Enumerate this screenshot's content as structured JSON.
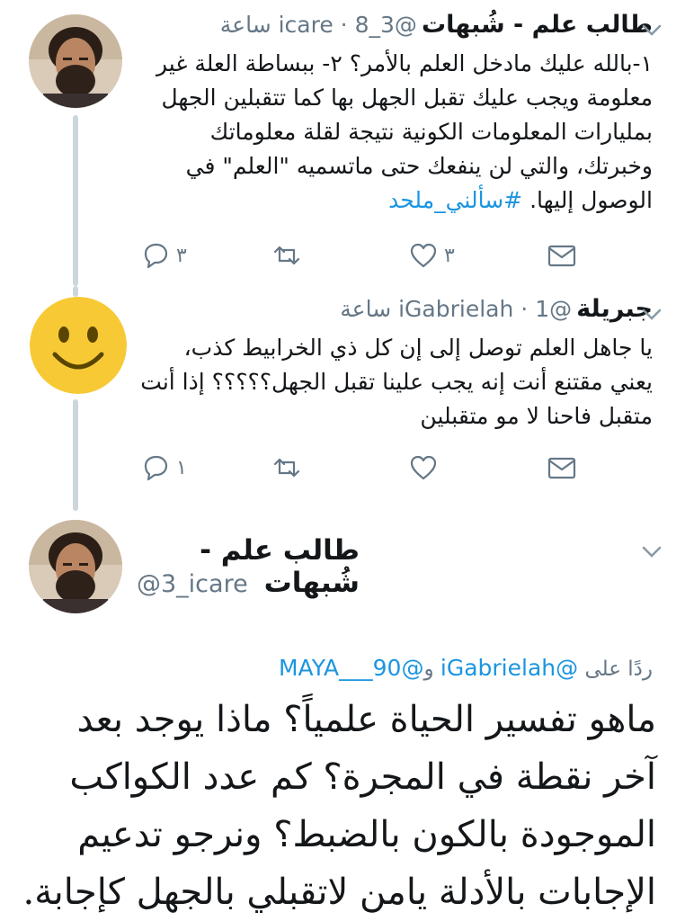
{
  "tweets": [
    {
      "name": "طالب علم - شُبهات",
      "handle": "@3_icare",
      "time": "8 ساعة",
      "body": "١-بالله عليك مادخل العلم بالأمر؟ ٢- ببساطة العلة غير معلومة ويجب عليك تقبل الجهل بها كما تتقبلين الجهل بمليارات المعلومات الكونية نتيجة لقلة معلوماتك وخبرتك، والتي لن ينفعك حتى ماتسميه \"العلم\" في الوصول إليها.",
      "hashtag": "#سألني_ملحد",
      "reply_count": "٣",
      "like_count": "٣",
      "avatar": "bearded-man-avatar"
    },
    {
      "name": "جبريلة",
      "handle": "@iGabrielah",
      "time": "1 ساعة",
      "body": "يا جاهل العلم توصل إلى إن كل ذي الخرابيط كذب، يعني مقتنع أنت إنه يجب علينا تقبل الجهل؟؟؟؟؟ إذا أنت متقبل فاحنا لا مو متقبلين",
      "reply_count": "١",
      "like_count": "",
      "avatar": "smiley-face-avatar"
    }
  ],
  "main_tweet": {
    "name": "طالب علم - شُبهات",
    "handle": "@3_icare",
    "reply_label": "ردًا على",
    "mention1": "@iGabrielah",
    "conjunction": "و",
    "mention2": "@MAYA___90",
    "body": "ماهو تفسير الحياة علمياً؟ ماذا يوجد بعد آخر نقطة في المجرة؟ كم عدد الكواكب الموجودة بالكون بالضبط؟ ونرجو تدعيم الإجابات بالأدلة يامن لاتقبلي بالجهل كإجابة."
  },
  "colors": {
    "link": "#1b95e0",
    "secondary_text": "#657786",
    "thread_line": "#ccd6dd",
    "icon": "#657786"
  }
}
